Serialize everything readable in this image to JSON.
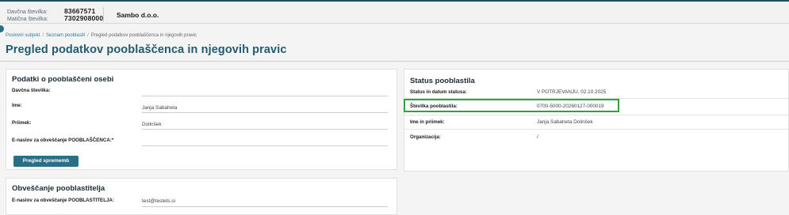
{
  "header": {
    "tax_label": "Davčna številka:",
    "tax_value": "83667571",
    "reg_label": "Matična številka:",
    "reg_value": "7302908000",
    "company_name": "Sambo d.o.o."
  },
  "breadcrumb": {
    "items": [
      "Poslovni subjekt",
      "Seznam pooblastil",
      "Pregled podatkov pooblaščenca in njegovih pravic"
    ]
  },
  "page_title": "Pregled podatkov pooblaščenca in njegovih pravic",
  "authorized_person": {
    "title": "Podatki o pooblaščeni osebi",
    "fields": [
      {
        "label": "Davčna številka:",
        "value": ""
      },
      {
        "label": "Ime:",
        "value": "Janja Sabaheta"
      },
      {
        "label": "Priimek:",
        "value": "Dolinšek"
      },
      {
        "label": "E-naslov za obveščanje POOBLAŠČENCA:*",
        "value": ""
      }
    ],
    "changes_button": "Pregled sprememb"
  },
  "notification": {
    "title": "Obveščanje pooblastitelja",
    "field_label": "E-naslov za obveščanje POOBLASTITELJA:",
    "field_value": "test@testets.si"
  },
  "status": {
    "title": "Status pooblastila",
    "rows": [
      {
        "label": "Status in datum statusa:",
        "value": "V POTRJEVANJU, 02.10.2025"
      },
      {
        "label": "Številka pooblastila:",
        "value": "0700-5000-20260127-000019"
      },
      {
        "label": "Ime in priimek:",
        "value": "Janja Sabaheta Dolinšek"
      },
      {
        "label": "Organizacija:",
        "value": "/"
      }
    ]
  },
  "colors": {
    "brand": "#235a6d",
    "button": "#2a6f88",
    "highlight": "#2aa53b",
    "link": "#2f7d9b"
  }
}
